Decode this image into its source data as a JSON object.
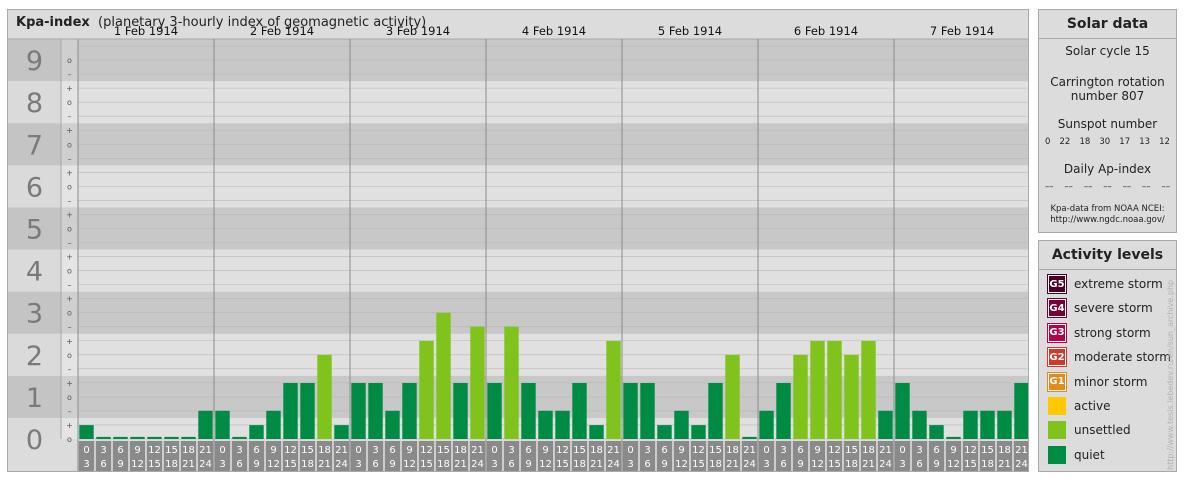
{
  "header": {
    "title": "Kpa-index",
    "subtitle": "(planetary 3-hourly index of geomagnetic activity)"
  },
  "chart_data": {
    "type": "bar",
    "title": "Kpa-index",
    "subtitle": "(planetary 3-hourly index of geomagnetic activity)",
    "ylim": [
      0,
      9
    ],
    "y_ticks": [
      "0",
      "1",
      "2",
      "3",
      "4",
      "5",
      "6",
      "7",
      "8",
      "9"
    ],
    "y_minor_labels": [
      "+",
      "o",
      "–"
    ],
    "days": [
      "1 Feb 1914",
      "2 Feb 1914",
      "3 Feb 1914",
      "4 Feb 1914",
      "5 Feb 1914",
      "6 Feb 1914",
      "7 Feb 1914"
    ],
    "slot_start_labels": [
      "0",
      "3",
      "6",
      "9",
      "12",
      "15",
      "18",
      "21"
    ],
    "slot_end_labels": [
      "3",
      "6",
      "9",
      "12",
      "15",
      "18",
      "21",
      "24"
    ],
    "values": [
      [
        0.33,
        0,
        0,
        0,
        0,
        0,
        0,
        0.67
      ],
      [
        0.67,
        0,
        0.33,
        0.67,
        1.33,
        1.33,
        2,
        0.33
      ],
      [
        1.33,
        1.33,
        0.67,
        1.33,
        2.33,
        3,
        1.33,
        2.67
      ],
      [
        1.33,
        2.67,
        1.33,
        0.67,
        0.67,
        1.33,
        0.33,
        2.33
      ],
      [
        1.33,
        1.33,
        0.33,
        0.67,
        0.33,
        1.33,
        2,
        0
      ],
      [
        0.67,
        1.33,
        2,
        2.33,
        2.33,
        2,
        2.33,
        0.67
      ],
      [
        1.33,
        0.67,
        0.33,
        0,
        0.67,
        0.67,
        0.67,
        1.33
      ]
    ],
    "grid": true,
    "colors": {
      "quiet": "#008b45",
      "unsettled": "#7fc31c",
      "active": "#ffc800",
      "minor_storm": "#e68a1a",
      "moderate_storm": "#d6372a",
      "strong_storm": "#b5004c",
      "severe_storm": "#780033",
      "extreme_storm": "#4c0026",
      "band_dark": "#c8c8c8",
      "band_light": "#e0e0e0"
    }
  },
  "solar": {
    "title": "Solar data",
    "cycle": "Solar cycle 15",
    "carrington_line1": "Carrington rotation",
    "carrington_line2": "number 807",
    "sunspot_label": "Sunspot number",
    "sunspot_values": [
      "0",
      "22",
      "18",
      "30",
      "17",
      "13",
      "12"
    ],
    "ap_label": "Daily Ap-index",
    "ap_values": [
      "––",
      "––",
      "––",
      "––",
      "––",
      "––",
      "––"
    ],
    "source_line1": "Kpa-data from NOAA NCEI:",
    "source_line2": "http://www.ngdc.noaa.gov/"
  },
  "activity": {
    "title": "Activity levels",
    "levels": [
      {
        "badge": "G5",
        "label": "extreme storm",
        "color": "#4c0026"
      },
      {
        "badge": "G4",
        "label": "severe storm",
        "color": "#780033"
      },
      {
        "badge": "G3",
        "label": "strong storm",
        "color": "#b5004c"
      },
      {
        "badge": "G2",
        "label": "moderate storm",
        "color": "#d6372a"
      },
      {
        "badge": "G1",
        "label": "minor storm",
        "color": "#e68a1a"
      },
      {
        "badge": "",
        "label": "active",
        "color": "#ffc800"
      },
      {
        "badge": "",
        "label": "unsettled",
        "color": "#7fc31c"
      },
      {
        "badge": "",
        "label": "quiet",
        "color": "#008b45"
      }
    ]
  },
  "watermark": "http://www.tesis.lebedev.ru/en/sun_archive.php"
}
